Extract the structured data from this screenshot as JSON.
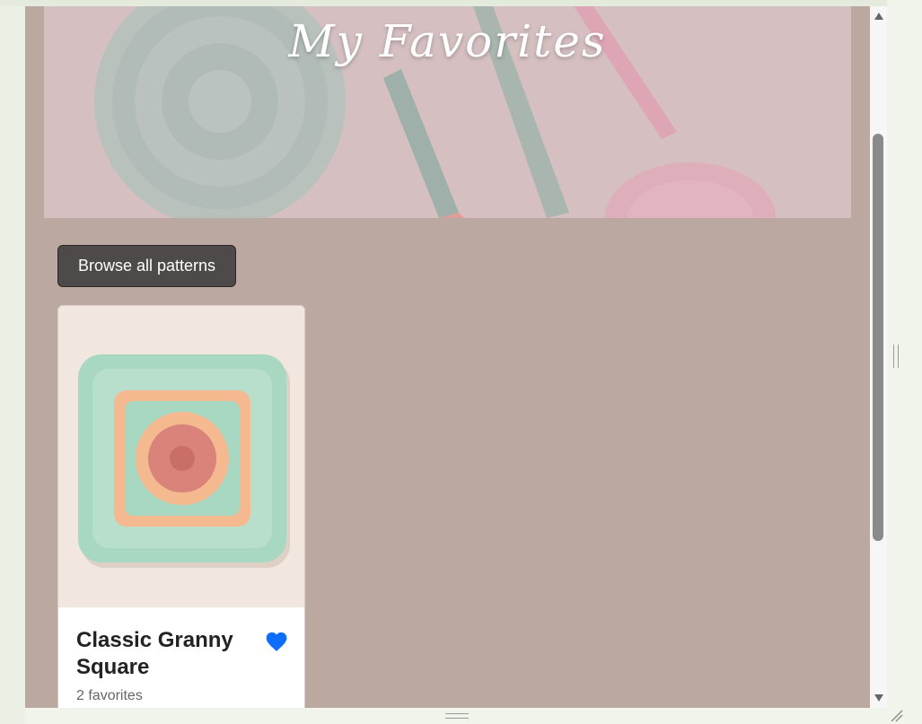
{
  "header": {
    "title": "My Favorites"
  },
  "actions": {
    "browse_label": "Browse all patterns"
  },
  "favorites": [
    {
      "title": "Classic Granny Square",
      "favorites_count": "2 favorites",
      "favorited": true
    }
  ],
  "colors": {
    "page_background": "#bba8a1",
    "button_background": "#4f4a4a",
    "heart": "#0d6efd",
    "yarn_mint": "#a9d8c2",
    "yarn_peach": "#f4b98e",
    "yarn_rose": "#d9837a"
  },
  "icons": {
    "favorite": "heart-icon",
    "scroll_up": "triangle-up-icon",
    "scroll_down": "triangle-down-icon"
  }
}
